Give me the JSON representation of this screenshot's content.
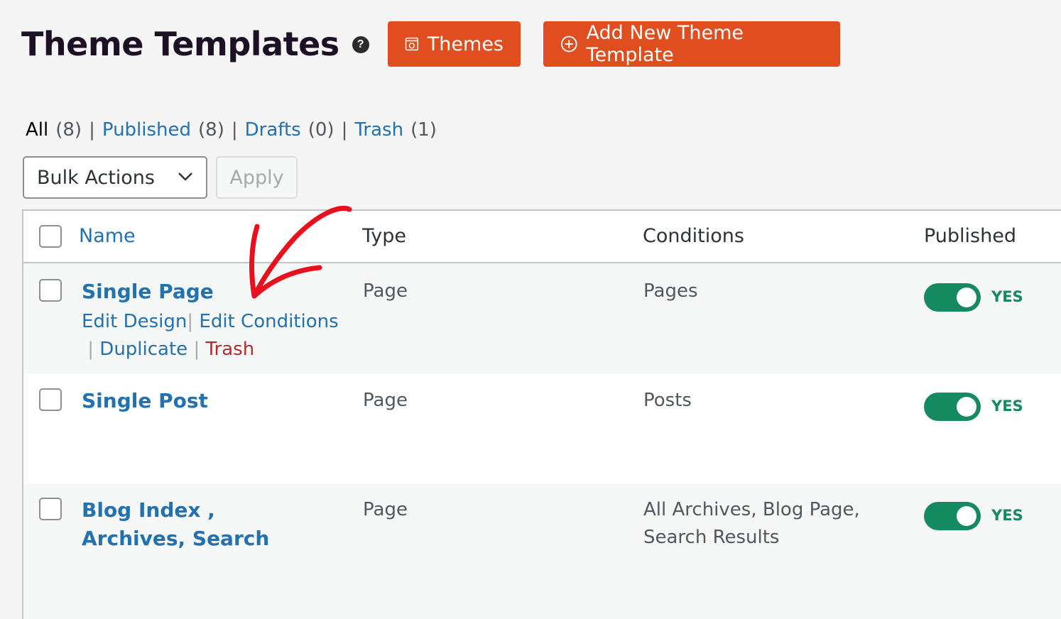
{
  "header": {
    "title": "Theme Templates",
    "help_glyph": "?",
    "themes_button": "Themes",
    "add_button": "Add New Theme Template"
  },
  "filters": {
    "all": "All",
    "all_count": "(8)",
    "published": "Published",
    "published_count": "(8)",
    "drafts": "Drafts",
    "drafts_count": "(0)",
    "trash": "Trash",
    "trash_count": "(1)",
    "separator": "|"
  },
  "bulk": {
    "select_value": "Bulk Actions",
    "apply_label": "Apply"
  },
  "table": {
    "headers": {
      "name": "Name",
      "type": "Type",
      "conditions": "Conditions",
      "published": "Published"
    },
    "rows": [
      {
        "name": "Single Page",
        "type": "Page",
        "conditions": "Pages",
        "published": "YES",
        "published_on": true
      },
      {
        "name": "Single Post",
        "type": "Page",
        "conditions": "Posts",
        "published": "YES",
        "published_on": true
      },
      {
        "name": "Blog Index , Archives, Search",
        "type": "Page",
        "conditions": "All Archives, Blog Page, Search Results",
        "published": "YES",
        "published_on": true
      }
    ],
    "row_actions": {
      "edit_design": "Edit Design",
      "edit_conditions": "Edit Conditions",
      "duplicate": "Duplicate",
      "trash": "Trash",
      "separator": "|"
    }
  },
  "colors": {
    "accent_orange": "#e04e1f",
    "link_blue": "#2271b1",
    "toggle_green": "#158960",
    "trash_red": "#b32d2e",
    "annotation_red": "#e8101c"
  },
  "icons": [
    "help-icon",
    "themes-icon",
    "plus-circle-icon",
    "chevron-down-icon",
    "annotation-arrow"
  ]
}
